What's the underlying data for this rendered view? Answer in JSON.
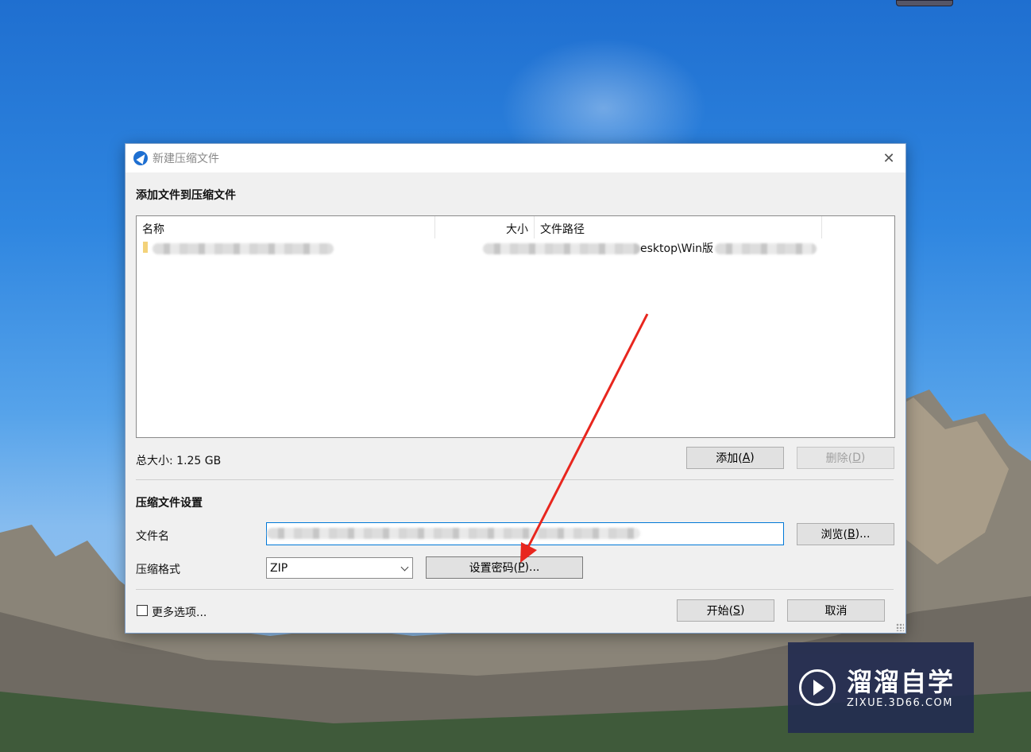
{
  "dialog": {
    "title": "新建压缩文件",
    "close_glyph": "✕",
    "add_files_heading": "添加文件到压缩文件",
    "list": {
      "columns": [
        "名称",
        "大小",
        "文件路径"
      ],
      "rows": [
        {
          "path_visible": "esktop\\Win版"
        }
      ]
    },
    "total_size": "总大小: 1.25 GB",
    "add_button": {
      "text": "添加(",
      "key": "A",
      "tail": ")"
    },
    "delete_button": {
      "text": "删除(",
      "key": "D",
      "tail": ")"
    },
    "settings_heading": "压缩文件设置",
    "filename_label": "文件名",
    "browse_button": {
      "text": "浏览(",
      "key": "B",
      "tail": ")..."
    },
    "format_label": "压缩格式",
    "format_value": "ZIP",
    "password_button": {
      "text": "设置密码(",
      "key": "P",
      "tail": ")..."
    },
    "more_options": "更多选项...",
    "start_button": {
      "text": "开始(",
      "key": "S",
      "tail": ")"
    },
    "cancel_button": "取消"
  },
  "watermark": {
    "cn": "溜溜自学",
    "en": "ZIXUE.3D66.COM"
  },
  "colors": {
    "focus_border": "#0078d7",
    "annotation_arrow": "#e8261e",
    "watermark_bg": "#232d50"
  }
}
